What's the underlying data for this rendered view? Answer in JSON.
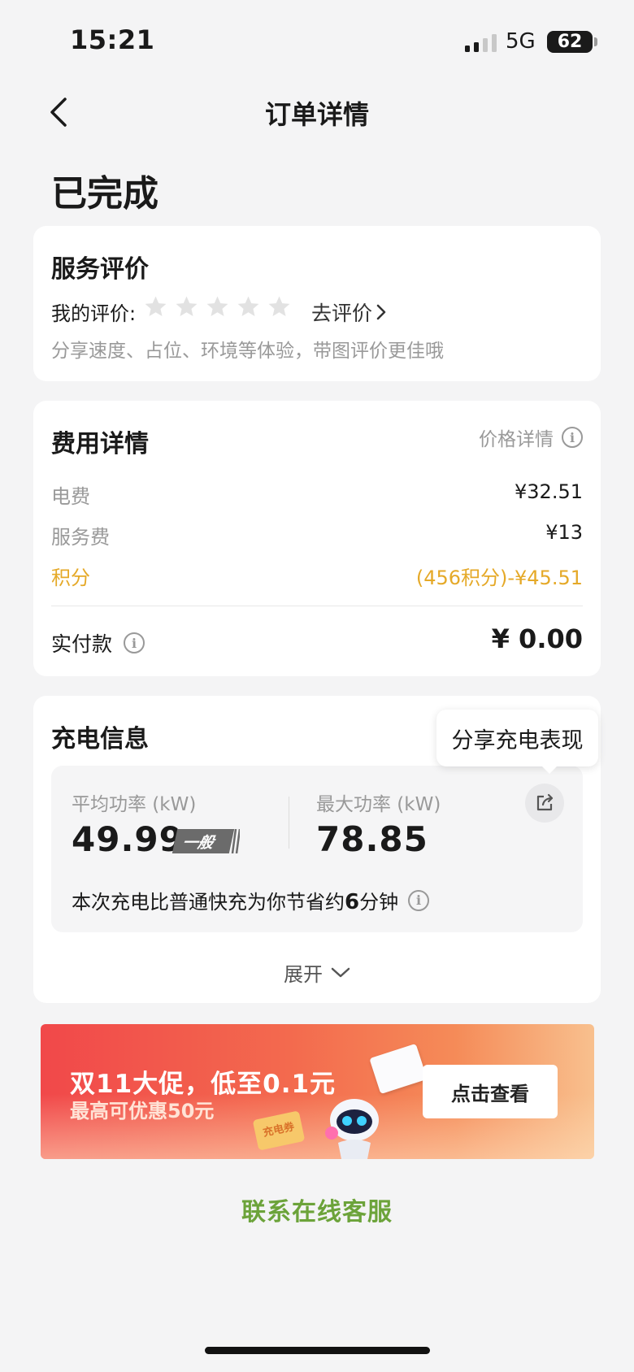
{
  "status_bar": {
    "time": "15:21",
    "network": "5G",
    "battery": "62"
  },
  "nav": {
    "title": "订单详情",
    "back_icon": "chevron-left-icon"
  },
  "order_status": "已完成",
  "rating": {
    "title": "服务评价",
    "my_rating_label": "我的评价:",
    "stars_total": 5,
    "stars_filled": 0,
    "go_rate_label": "去评价",
    "hint": "分享速度、占位、环境等体验，带图评价更佳哦"
  },
  "fee": {
    "title": "费用详情",
    "price_detail_label": "价格详情",
    "rows": [
      {
        "label": "电费",
        "value": "¥32.51"
      },
      {
        "label": "服务费",
        "value": "¥13"
      },
      {
        "label": "积分",
        "value": "(456积分)-¥45.51"
      }
    ],
    "paid_label": "实付款",
    "paid_value": "¥ 0.00"
  },
  "charge": {
    "title": "充电信息",
    "avg_power_label": "平均功率 (kW)",
    "avg_power_value": "49.99",
    "avg_badge": "一般",
    "max_power_label": "最大功率 (kW)",
    "max_power_value": "78.85",
    "save_prefix": "本次充电比普通快充为你节省约",
    "save_amount": "6",
    "save_suffix": "分钟",
    "expand_label": "展开",
    "share_tooltip": "分享充电表现"
  },
  "promo": {
    "title": "双11大促，低至0.1元",
    "subtitle": "最高可优惠50元",
    "button_label": "点击查看",
    "coupon_text": "充电券"
  },
  "support_label": "联系在线客服",
  "colors": {
    "points": "#e5a928",
    "support_link": "#6ca33a",
    "promo_start": "#f1484a",
    "promo_end": "#f8c08e"
  }
}
